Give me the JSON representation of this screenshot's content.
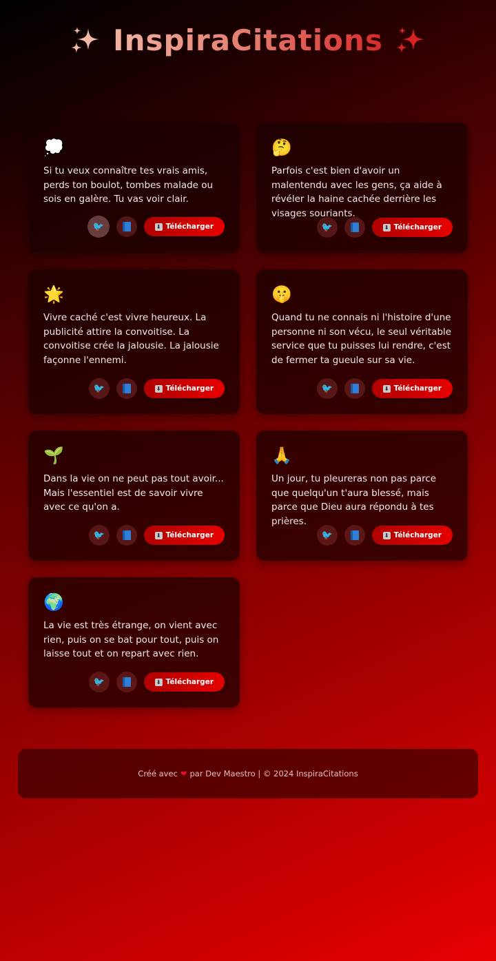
{
  "header": {
    "title": "InspiraCitations"
  },
  "quotes": [
    {
      "emoji": "💭",
      "text": "Si tu veux connaître tes vrais amis, perds ton boulot, tombes malade ou sois en galère. Tu vas voir clair."
    },
    {
      "emoji": "🤔",
      "text": "Parfois c'est bien d'avoir un malentendu avec les gens, ça aide à révéler la haine cachée derrière les visages souriants."
    },
    {
      "emoji": "🌟",
      "text": "Vivre caché c'est vivre heureux. La publicité attire la convoitise. La convoitise crée la jalousie. La jalousie façonne l'ennemi."
    },
    {
      "emoji": "🤫",
      "text": "Quand tu ne connais ni l'histoire d'une personne ni son vécu, le seul véritable service que tu puisses lui rendre, c'est de fermer ta gueule sur sa vie."
    },
    {
      "emoji": "🌱",
      "text": "Dans la vie on ne peut pas tout avoir... Mais l'essentiel est de savoir vivre avec ce qu'on a."
    },
    {
      "emoji": "🙏",
      "text": "Un jour, tu pleureras non pas parce que quelqu'un t'aura blessé, mais parce que Dieu aura répondu à tes prières."
    },
    {
      "emoji": "🌍",
      "text": "La vie est très étrange, on vient avec rien, puis on se bat pour tout, puis on laisse tout et on repart avec rien."
    }
  ],
  "actions": {
    "twitter_icon": "twitter-bird-icon",
    "facebook_icon": "blue-book-icon",
    "download_label": "Télécharger"
  },
  "footer": {
    "text_before": "Créé avec",
    "text_after": "par Dev Maestro | © 2024 InspiraCitations"
  },
  "colors": {
    "accent": "#e60000",
    "card_bg": "#190000",
    "title_gradient_start": "#f2b3a3",
    "title_gradient_end": "#d62a2a"
  }
}
